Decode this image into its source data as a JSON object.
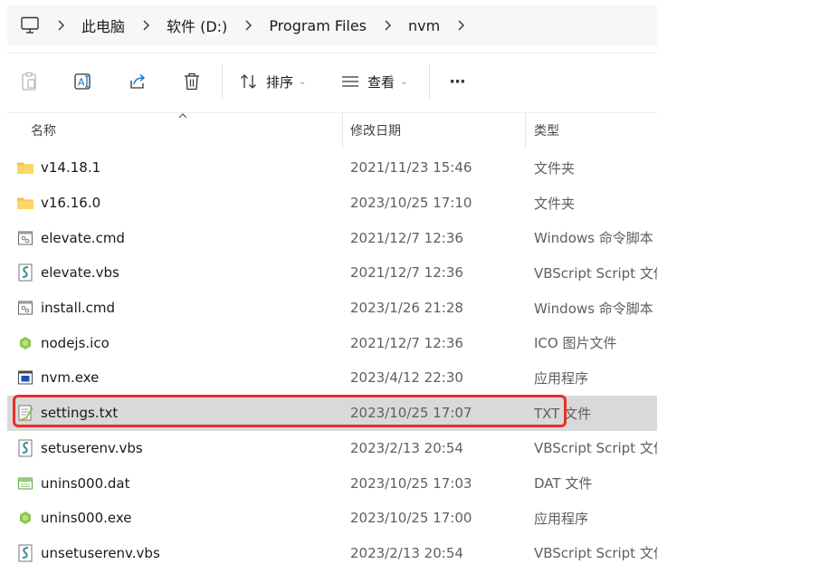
{
  "breadcrumb": {
    "items": [
      {
        "label": "此电脑"
      },
      {
        "label": "软件 (D:)"
      },
      {
        "label": "Program Files"
      },
      {
        "label": "nvm"
      }
    ]
  },
  "toolbar": {
    "sort_label": "排序",
    "view_label": "查看",
    "more_label": "···"
  },
  "columns": {
    "name": "名称",
    "date": "修改日期",
    "type": "类型"
  },
  "files": [
    {
      "name": "v14.18.1",
      "date": "2021/11/23 15:46",
      "type": "文件夹",
      "icon": "folder-icon"
    },
    {
      "name": "v16.16.0",
      "date": "2023/10/25 17:10",
      "type": "文件夹",
      "icon": "folder-icon"
    },
    {
      "name": "elevate.cmd",
      "date": "2021/12/7 12:36",
      "type": "Windows 命令脚本",
      "icon": "cmd-file-icon"
    },
    {
      "name": "elevate.vbs",
      "date": "2021/12/7 12:36",
      "type": "VBScript Script 文件",
      "icon": "vbs-file-icon"
    },
    {
      "name": "install.cmd",
      "date": "2023/1/26 21:28",
      "type": "Windows 命令脚本",
      "icon": "cmd-file-icon"
    },
    {
      "name": "nodejs.ico",
      "date": "2021/12/7 12:36",
      "type": "ICO 图片文件",
      "icon": "ico-file-icon"
    },
    {
      "name": "nvm.exe",
      "date": "2023/4/12 22:30",
      "type": "应用程序",
      "icon": "exe-file-icon"
    },
    {
      "name": "settings.txt",
      "date": "2023/10/25 17:07",
      "type": "TXT 文件",
      "icon": "txt-file-icon",
      "selected": true
    },
    {
      "name": "setuserenv.vbs",
      "date": "2023/2/13 20:54",
      "type": "VBScript Script 文件",
      "icon": "vbs-file-icon"
    },
    {
      "name": "unins000.dat",
      "date": "2023/10/25 17:03",
      "type": "DAT 文件",
      "icon": "dat-file-icon"
    },
    {
      "name": "unins000.exe",
      "date": "2023/10/25 17:00",
      "type": "应用程序",
      "icon": "ico-file-icon"
    },
    {
      "name": "unsetuserenv.vbs",
      "date": "2023/2/13 20:54",
      "type": "VBScript Script 文件",
      "icon": "vbs-file-icon"
    }
  ],
  "colors": {
    "highlight": "#e8302a",
    "selected_row": "#d9d9d9",
    "folder": "#f5c24c"
  }
}
